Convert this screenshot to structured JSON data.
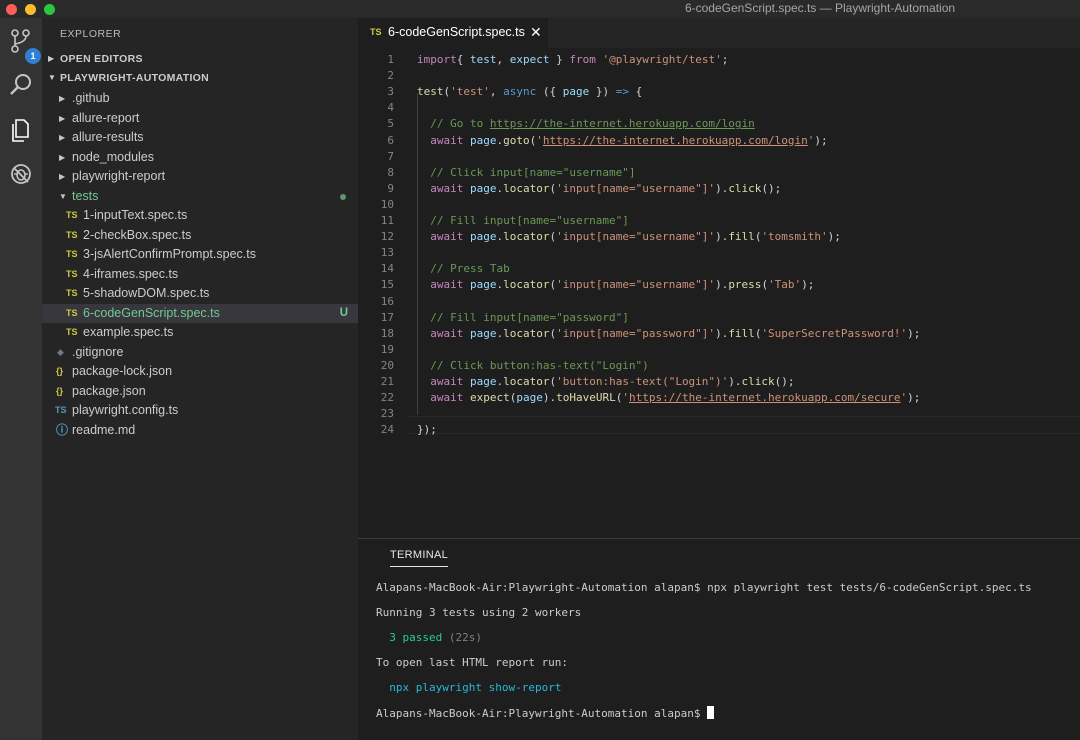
{
  "window": {
    "title": "6-codeGenScript.spec.ts — Playwright-Automation"
  },
  "activity_bar": {
    "scm_badge": "1"
  },
  "sidebar": {
    "title": "EXPLORER",
    "open_editors": "OPEN EDITORS",
    "project": "PLAYWRIGHT-AUTOMATION",
    "items": [
      {
        "name": ".github",
        "type": "folder"
      },
      {
        "name": "allure-report",
        "type": "folder"
      },
      {
        "name": "allure-results",
        "type": "folder"
      },
      {
        "name": "node_modules",
        "type": "folder"
      },
      {
        "name": "playwright-report",
        "type": "folder"
      },
      {
        "name": "tests",
        "type": "folder-open"
      },
      {
        "name": "1-inputText.spec.ts",
        "icon": "TS"
      },
      {
        "name": "2-checkBox.spec.ts",
        "icon": "TS"
      },
      {
        "name": "3-jsAlertConfirmPrompt.spec.ts",
        "icon": "TS"
      },
      {
        "name": "4-iframes.spec.ts",
        "icon": "TS"
      },
      {
        "name": "5-shadowDOM.spec.ts",
        "icon": "TS"
      },
      {
        "name": "6-codeGenScript.spec.ts",
        "icon": "TS",
        "status": "U"
      },
      {
        "name": "example.spec.ts",
        "icon": "TS"
      },
      {
        "name": ".gitignore",
        "icon": "◆"
      },
      {
        "name": "package-lock.json",
        "icon": "{}"
      },
      {
        "name": "package.json",
        "icon": "{}"
      },
      {
        "name": "playwright.config.ts",
        "icon": "TS"
      },
      {
        "name": "readme.md",
        "icon": "ⓘ"
      }
    ]
  },
  "tab": {
    "icon": "TS",
    "label": "6-codeGenScript.spec.ts",
    "close": "✕"
  },
  "editor": {
    "line_numbers": [
      "1",
      "2",
      "3",
      "4",
      "5",
      "6",
      "7",
      "8",
      "9",
      "10",
      "11",
      "12",
      "13",
      "14",
      "15",
      "16",
      "17",
      "18",
      "19",
      "20",
      "21",
      "22",
      "23",
      "24"
    ],
    "lines": [
      [
        [
          "k",
          "import"
        ],
        [
          "",
          "{ "
        ],
        [
          "v",
          "test"
        ],
        [
          "",
          ", "
        ],
        [
          "v",
          "expect"
        ],
        [
          "",
          " } "
        ],
        [
          "k",
          "from"
        ],
        [
          "",
          " "
        ],
        [
          "s",
          "'@playwright/test'"
        ],
        [
          "",
          ";"
        ]
      ],
      [],
      [
        [
          "f",
          "test"
        ],
        [
          "",
          "("
        ],
        [
          "s",
          "'test'"
        ],
        [
          "",
          ", "
        ],
        [
          "kb",
          "async"
        ],
        [
          "",
          " ({ "
        ],
        [
          "v",
          "page"
        ],
        [
          "",
          " }) "
        ],
        [
          "kb",
          "=>"
        ],
        [
          "",
          " {"
        ]
      ],
      [],
      [
        [
          "c",
          "  // Go to "
        ],
        [
          "cu",
          "https://the-internet.herokuapp.com/login"
        ]
      ],
      [
        [
          "",
          "  "
        ],
        [
          "k",
          "await"
        ],
        [
          "",
          " "
        ],
        [
          "v",
          "page"
        ],
        [
          "",
          "."
        ],
        [
          "f",
          "goto"
        ],
        [
          "",
          "("
        ],
        [
          "s",
          "'"
        ],
        [
          "su",
          "https://the-internet.herokuapp.com/login"
        ],
        [
          "s",
          "'"
        ],
        [
          "",
          ");"
        ]
      ],
      [],
      [
        [
          "c",
          "  // Click input[name=\"username\"]"
        ]
      ],
      [
        [
          "",
          "  "
        ],
        [
          "k",
          "await"
        ],
        [
          "",
          " "
        ],
        [
          "v",
          "page"
        ],
        [
          "",
          "."
        ],
        [
          "f",
          "locator"
        ],
        [
          "",
          "("
        ],
        [
          "s",
          "'input[name=\"username\"]'"
        ],
        [
          "",
          ")."
        ],
        [
          "f",
          "click"
        ],
        [
          "",
          "();"
        ]
      ],
      [],
      [
        [
          "c",
          "  // Fill input[name=\"username\"]"
        ]
      ],
      [
        [
          "",
          "  "
        ],
        [
          "k",
          "await"
        ],
        [
          "",
          " "
        ],
        [
          "v",
          "page"
        ],
        [
          "",
          "."
        ],
        [
          "f",
          "locator"
        ],
        [
          "",
          "("
        ],
        [
          "s",
          "'input[name=\"username\"]'"
        ],
        [
          "",
          ")."
        ],
        [
          "f",
          "fill"
        ],
        [
          "",
          "("
        ],
        [
          "s",
          "'tomsmith'"
        ],
        [
          "",
          ");"
        ]
      ],
      [],
      [
        [
          "c",
          "  // Press Tab"
        ]
      ],
      [
        [
          "",
          "  "
        ],
        [
          "k",
          "await"
        ],
        [
          "",
          " "
        ],
        [
          "v",
          "page"
        ],
        [
          "",
          "."
        ],
        [
          "f",
          "locator"
        ],
        [
          "",
          "("
        ],
        [
          "s",
          "'input[name=\"username\"]'"
        ],
        [
          "",
          ")."
        ],
        [
          "f",
          "press"
        ],
        [
          "",
          "("
        ],
        [
          "s",
          "'Tab'"
        ],
        [
          "",
          ");"
        ]
      ],
      [],
      [
        [
          "c",
          "  // Fill input[name=\"password\"]"
        ]
      ],
      [
        [
          "",
          "  "
        ],
        [
          "k",
          "await"
        ],
        [
          "",
          " "
        ],
        [
          "v",
          "page"
        ],
        [
          "",
          "."
        ],
        [
          "f",
          "locator"
        ],
        [
          "",
          "("
        ],
        [
          "s",
          "'input[name=\"password\"]'"
        ],
        [
          "",
          ")."
        ],
        [
          "f",
          "fill"
        ],
        [
          "",
          "("
        ],
        [
          "s",
          "'SuperSecretPassword!'"
        ],
        [
          "",
          ");"
        ]
      ],
      [],
      [
        [
          "c",
          "  // Click button:has-text(\"Login\")"
        ]
      ],
      [
        [
          "",
          "  "
        ],
        [
          "k",
          "await"
        ],
        [
          "",
          " "
        ],
        [
          "v",
          "page"
        ],
        [
          "",
          "."
        ],
        [
          "f",
          "locator"
        ],
        [
          "",
          "("
        ],
        [
          "s",
          "'button:has-text(\"Login\")'"
        ],
        [
          "",
          ")."
        ],
        [
          "f",
          "click"
        ],
        [
          "",
          "();"
        ]
      ],
      [
        [
          "",
          "  "
        ],
        [
          "k",
          "await"
        ],
        [
          "",
          " "
        ],
        [
          "f",
          "expect"
        ],
        [
          "",
          "("
        ],
        [
          "v",
          "page"
        ],
        [
          "",
          ")."
        ],
        [
          "f",
          "toHaveURL"
        ],
        [
          "",
          "("
        ],
        [
          "s",
          "'"
        ],
        [
          "su",
          "https://the-internet.herokuapp.com/secure"
        ],
        [
          "s",
          "'"
        ],
        [
          "",
          ");"
        ]
      ],
      [],
      [
        [
          "",
          "});"
        ]
      ]
    ]
  },
  "terminal": {
    "tab": "TERMINAL",
    "command_line": "Alapans-MacBook-Air:Playwright-Automation alapan$ npx playwright test tests/6-codeGenScript.spec.ts",
    "running": "Running 3 tests using 2 workers",
    "passed": "3 passed",
    "duration": "(22s)",
    "report_hint": "To open last HTML report run:",
    "report_cmd": "npx playwright show-report",
    "prompt": "Alapans-MacBook-Air:Playwright-Automation alapan$ "
  }
}
